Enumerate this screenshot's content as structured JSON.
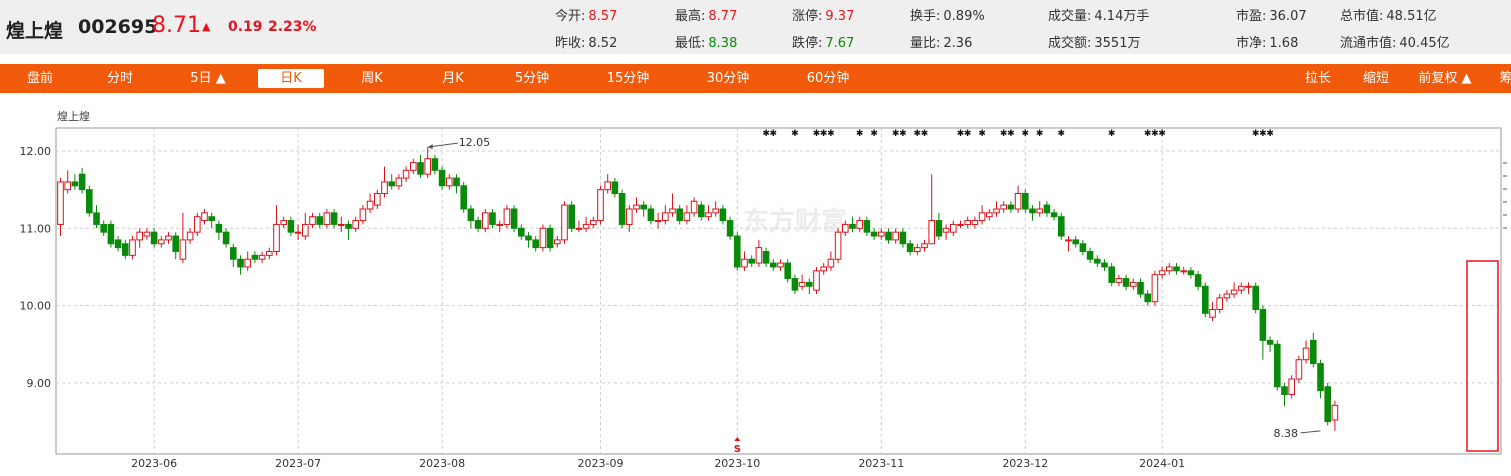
{
  "header": {
    "name": "煌上煌",
    "code": "002695",
    "price": "8.71",
    "arrow": "▲",
    "change": "0.19",
    "change_pct": "2.23%",
    "quotes": [
      {
        "label": "今开:",
        "value": "8.57",
        "color": "red"
      },
      {
        "label": "昨收:",
        "value": "8.52",
        "color": ""
      },
      {
        "label": "最高:",
        "value": "8.77",
        "color": "red"
      },
      {
        "label": "最低:",
        "value": "8.38",
        "color": "green"
      },
      {
        "label": "涨停:",
        "value": "9.37",
        "color": "red"
      },
      {
        "label": "跌停:",
        "value": "7.67",
        "color": "green"
      },
      {
        "label": "换手:",
        "value": "0.89%",
        "color": ""
      },
      {
        "label": "量比:",
        "value": "2.36",
        "color": ""
      },
      {
        "label": "成交量:",
        "value": "4.14万手",
        "color": ""
      },
      {
        "label": "成交额:",
        "value": "3551万",
        "color": ""
      },
      {
        "label": "市盈:",
        "value": "36.07",
        "color": ""
      },
      {
        "label": "市净:",
        "value": "1.68",
        "color": ""
      },
      {
        "label": "总市值:",
        "value": "48.51亿",
        "color": ""
      },
      {
        "label": "流通市值:",
        "value": "40.45亿",
        "color": ""
      }
    ]
  },
  "tabs": {
    "left": [
      "盘前",
      "分时",
      "5日 ▲",
      "日K",
      "周K",
      "月K",
      "5分钟",
      "15分钟",
      "30分钟",
      "60分钟"
    ],
    "active": "日K",
    "right": [
      "拉长",
      "缩短",
      "前复权 ▲",
      "筹"
    ]
  },
  "colors": {
    "up": "#d8141d",
    "down": "#0a8a0a",
    "accent": "#f05a0a",
    "highlight_box": "#e8141d"
  },
  "chart_data": {
    "type": "candlestick",
    "title": "煌上煌",
    "ylim": [
      8.3,
      12.3
    ],
    "yticks": [
      "12.00",
      "11.00",
      "10.00",
      "9.00"
    ],
    "ytick_values": [
      12,
      11,
      10,
      9
    ],
    "xticks": [
      "2023-06",
      "2023-07",
      "2023-08",
      "2023-09",
      "2023-10",
      "2023-11",
      "2023-12",
      "2024-01"
    ],
    "xtick_index": [
      13,
      33,
      53,
      75,
      94,
      114,
      134,
      153
    ],
    "annotations": [
      {
        "text": "12.05",
        "index": 51,
        "value": 12.05
      },
      {
        "text": "8.38",
        "index": 175,
        "value": 8.38
      }
    ],
    "watermark": "东方财富",
    "marker_text": "S",
    "marker_index": 94,
    "star_symbol": "✱",
    "star_indices": [
      98,
      99,
      102,
      105,
      106,
      107,
      111,
      113,
      116,
      117,
      119,
      120,
      125,
      126,
      128,
      131,
      132,
      134,
      136,
      139,
      146,
      151,
      152,
      153,
      166,
      167,
      168
    ],
    "candles": [
      [
        11.05,
        11.6,
        11.65,
        10.9
      ],
      [
        11.5,
        11.6,
        11.75,
        11.45
      ],
      [
        11.6,
        11.55,
        11.7,
        11.5
      ],
      [
        11.7,
        11.5,
        11.78,
        11.45
      ],
      [
        11.5,
        11.2,
        11.55,
        11.15
      ],
      [
        11.2,
        11.05,
        11.3,
        11.0
      ],
      [
        11.05,
        10.95,
        11.1,
        10.9
      ],
      [
        11.05,
        10.8,
        11.1,
        10.75
      ],
      [
        10.85,
        10.75,
        10.9,
        10.7
      ],
      [
        10.8,
        10.65,
        10.85,
        10.6
      ],
      [
        10.65,
        10.85,
        10.9,
        10.6
      ],
      [
        10.85,
        10.95,
        11.0,
        10.75
      ],
      [
        10.9,
        10.95,
        11.0,
        10.85
      ],
      [
        10.95,
        10.8,
        11.0,
        10.75
      ],
      [
        10.8,
        10.85,
        10.9,
        10.75
      ],
      [
        10.85,
        10.9,
        10.95,
        10.8
      ],
      [
        10.9,
        10.7,
        10.95,
        10.6
      ],
      [
        10.6,
        10.85,
        11.2,
        10.55
      ],
      [
        10.85,
        10.95,
        11.0,
        10.8
      ],
      [
        10.95,
        11.15,
        11.2,
        10.9
      ],
      [
        11.1,
        11.2,
        11.25,
        11.05
      ],
      [
        11.15,
        11.1,
        11.2,
        11.0
      ],
      [
        11.05,
        10.95,
        11.1,
        10.85
      ],
      [
        10.95,
        10.8,
        11.0,
        10.75
      ],
      [
        10.75,
        10.6,
        10.8,
        10.5
      ],
      [
        10.6,
        10.5,
        10.65,
        10.4
      ],
      [
        10.5,
        10.6,
        10.7,
        10.45
      ],
      [
        10.65,
        10.6,
        10.7,
        10.55
      ],
      [
        10.6,
        10.65,
        10.7,
        10.55
      ],
      [
        10.65,
        10.7,
        10.75,
        10.6
      ],
      [
        10.7,
        11.05,
        11.3,
        10.65
      ],
      [
        11.05,
        11.1,
        11.15,
        11.0
      ],
      [
        11.1,
        10.95,
        11.15,
        10.9
      ],
      [
        10.95,
        10.95,
        11.05,
        10.85
      ],
      [
        10.9,
        11.05,
        11.2,
        10.85
      ],
      [
        11.05,
        11.15,
        11.2,
        11.0
      ],
      [
        11.15,
        11.05,
        11.2,
        11.0
      ],
      [
        11.05,
        11.2,
        11.25,
        11.0
      ],
      [
        11.2,
        11.05,
        11.25,
        11.0
      ],
      [
        11.05,
        11.05,
        11.15,
        10.95
      ],
      [
        11.05,
        11.0,
        11.1,
        10.85
      ],
      [
        11.0,
        11.1,
        11.15,
        10.95
      ],
      [
        11.1,
        11.25,
        11.3,
        11.05
      ],
      [
        11.25,
        11.35,
        11.45,
        11.2
      ],
      [
        11.3,
        11.45,
        11.5,
        11.25
      ],
      [
        11.45,
        11.6,
        11.8,
        11.4
      ],
      [
        11.6,
        11.55,
        11.7,
        11.5
      ],
      [
        11.55,
        11.65,
        11.7,
        11.5
      ],
      [
        11.65,
        11.75,
        11.8,
        11.6
      ],
      [
        11.75,
        11.85,
        11.9,
        11.7
      ],
      [
        11.85,
        11.7,
        11.95,
        11.65
      ],
      [
        11.7,
        11.9,
        12.05,
        11.65
      ],
      [
        11.9,
        11.75,
        11.95,
        11.7
      ],
      [
        11.75,
        11.55,
        11.8,
        11.5
      ],
      [
        11.55,
        11.65,
        11.7,
        11.5
      ],
      [
        11.65,
        11.55,
        11.7,
        11.45
      ],
      [
        11.55,
        11.25,
        11.6,
        11.2
      ],
      [
        11.25,
        11.1,
        11.3,
        11.0
      ],
      [
        11.1,
        11.0,
        11.15,
        10.95
      ],
      [
        11.0,
        11.2,
        11.25,
        10.95
      ],
      [
        11.2,
        11.05,
        11.25,
        11.0
      ],
      [
        11.05,
        11.05,
        11.1,
        10.95
      ],
      [
        11.05,
        11.25,
        11.3,
        11.0
      ],
      [
        11.25,
        11.0,
        11.3,
        10.95
      ],
      [
        11.0,
        10.9,
        11.05,
        10.85
      ],
      [
        10.9,
        10.85,
        10.95,
        10.75
      ],
      [
        10.85,
        10.75,
        10.9,
        10.7
      ],
      [
        10.75,
        11.0,
        11.05,
        10.7
      ],
      [
        11.0,
        10.75,
        11.05,
        10.7
      ],
      [
        10.8,
        10.85,
        10.9,
        10.75
      ],
      [
        10.85,
        11.3,
        11.35,
        10.8
      ],
      [
        11.3,
        11.0,
        11.35,
        10.95
      ],
      [
        11.0,
        11.0,
        11.1,
        10.95
      ],
      [
        11.0,
        11.05,
        11.15,
        10.95
      ],
      [
        11.05,
        11.1,
        11.15,
        11.0
      ],
      [
        11.1,
        11.5,
        11.55,
        11.05
      ],
      [
        11.5,
        11.6,
        11.7,
        11.45
      ],
      [
        11.6,
        11.45,
        11.65,
        11.4
      ],
      [
        11.45,
        11.05,
        11.5,
        11.0
      ],
      [
        11.05,
        11.25,
        11.3,
        10.95
      ],
      [
        11.25,
        11.3,
        11.4,
        11.2
      ],
      [
        11.3,
        11.25,
        11.35,
        11.15
      ],
      [
        11.25,
        11.1,
        11.3,
        11.05
      ],
      [
        11.1,
        11.1,
        11.2,
        11.0
      ],
      [
        11.1,
        11.2,
        11.3,
        11.05
      ],
      [
        11.2,
        11.25,
        11.45,
        11.15
      ],
      [
        11.25,
        11.1,
        11.3,
        11.05
      ],
      [
        11.1,
        11.2,
        11.3,
        11.05
      ],
      [
        11.2,
        11.35,
        11.4,
        11.15
      ],
      [
        11.3,
        11.15,
        11.35,
        11.1
      ],
      [
        11.15,
        11.2,
        11.3,
        11.1
      ],
      [
        11.2,
        11.25,
        11.35,
        11.15
      ],
      [
        11.25,
        11.1,
        11.3,
        11.05
      ],
      [
        11.1,
        10.9,
        11.15,
        10.85
      ],
      [
        10.9,
        10.5,
        10.95,
        10.45
      ],
      [
        10.5,
        10.6,
        10.7,
        10.45
      ],
      [
        10.6,
        10.55,
        10.65,
        10.5
      ],
      [
        10.55,
        10.75,
        10.85,
        10.5
      ],
      [
        10.7,
        10.55,
        10.75,
        10.5
      ],
      [
        10.55,
        10.5,
        10.6,
        10.45
      ],
      [
        10.5,
        10.55,
        10.6,
        10.45
      ],
      [
        10.55,
        10.35,
        10.6,
        10.3
      ],
      [
        10.35,
        10.2,
        10.4,
        10.15
      ],
      [
        10.25,
        10.3,
        10.4,
        10.2
      ],
      [
        10.3,
        10.25,
        10.35,
        10.15
      ],
      [
        10.2,
        10.45,
        10.5,
        10.15
      ],
      [
        10.45,
        10.5,
        10.55,
        10.4
      ],
      [
        10.5,
        10.6,
        10.7,
        10.45
      ],
      [
        10.6,
        10.95,
        11.0,
        10.55
      ],
      [
        10.95,
        11.05,
        11.1,
        10.9
      ],
      [
        11.05,
        11.0,
        11.15,
        10.95
      ],
      [
        11.0,
        11.1,
        11.15,
        10.95
      ],
      [
        11.1,
        10.95,
        11.15,
        10.9
      ],
      [
        10.95,
        10.9,
        11.0,
        10.85
      ],
      [
        10.9,
        10.95,
        11.0,
        10.85
      ],
      [
        10.95,
        10.85,
        11.0,
        10.8
      ],
      [
        10.85,
        10.95,
        11.0,
        10.8
      ],
      [
        10.95,
        10.8,
        11.0,
        10.75
      ],
      [
        10.8,
        10.7,
        10.85,
        10.65
      ],
      [
        10.7,
        10.75,
        10.8,
        10.65
      ],
      [
        10.75,
        10.8,
        10.85,
        10.7
      ],
      [
        10.8,
        11.1,
        11.7,
        10.8
      ],
      [
        11.1,
        10.9,
        11.2,
        10.85
      ],
      [
        10.95,
        11.0,
        11.05,
        10.85
      ],
      [
        10.95,
        11.05,
        11.1,
        10.9
      ],
      [
        11.05,
        11.05,
        11.1,
        11.0
      ],
      [
        11.05,
        11.1,
        11.15,
        11.0
      ],
      [
        11.05,
        11.1,
        11.15,
        11.0
      ],
      [
        11.1,
        11.2,
        11.3,
        11.05
      ],
      [
        11.15,
        11.2,
        11.25,
        11.1
      ],
      [
        11.2,
        11.25,
        11.35,
        11.15
      ],
      [
        11.25,
        11.3,
        11.35,
        11.2
      ],
      [
        11.3,
        11.25,
        11.35,
        11.2
      ],
      [
        11.25,
        11.45,
        11.55,
        11.2
      ],
      [
        11.45,
        11.25,
        11.5,
        11.2
      ],
      [
        11.25,
        11.2,
        11.3,
        11.1
      ],
      [
        11.2,
        11.25,
        11.35,
        11.15
      ],
      [
        11.3,
        11.2,
        11.35,
        11.15
      ],
      [
        11.2,
        11.15,
        11.25,
        11.1
      ],
      [
        11.15,
        10.9,
        11.2,
        10.85
      ],
      [
        10.85,
        10.85,
        10.9,
        10.7
      ],
      [
        10.85,
        10.8,
        10.9,
        10.75
      ],
      [
        10.8,
        10.7,
        10.85,
        10.65
      ],
      [
        10.7,
        10.6,
        10.75,
        10.55
      ],
      [
        10.6,
        10.55,
        10.65,
        10.5
      ],
      [
        10.55,
        10.5,
        10.6,
        10.45
      ],
      [
        10.5,
        10.3,
        10.55,
        10.25
      ],
      [
        10.3,
        10.35,
        10.4,
        10.25
      ],
      [
        10.35,
        10.25,
        10.4,
        10.2
      ],
      [
        10.25,
        10.3,
        10.35,
        10.2
      ],
      [
        10.3,
        10.15,
        10.35,
        10.1
      ],
      [
        10.15,
        10.05,
        10.2,
        10.0
      ],
      [
        10.05,
        10.4,
        10.45,
        10.0
      ],
      [
        10.4,
        10.45,
        10.5,
        10.35
      ],
      [
        10.45,
        10.5,
        10.55,
        10.4
      ],
      [
        10.5,
        10.45,
        10.55,
        10.4
      ],
      [
        10.45,
        10.45,
        10.5,
        10.4
      ],
      [
        10.45,
        10.4,
        10.5,
        10.35
      ],
      [
        10.4,
        10.25,
        10.45,
        10.2
      ],
      [
        10.25,
        9.9,
        10.3,
        9.85
      ],
      [
        9.85,
        9.95,
        10.05,
        9.8
      ],
      [
        9.95,
        10.1,
        10.15,
        9.9
      ],
      [
        10.1,
        10.15,
        10.2,
        10.05
      ],
      [
        10.15,
        10.2,
        10.3,
        10.1
      ],
      [
        10.2,
        10.25,
        10.3,
        10.15
      ],
      [
        10.25,
        10.25,
        10.3,
        10.15
      ],
      [
        10.25,
        9.95,
        10.3,
        9.9
      ],
      [
        9.95,
        9.55,
        10.0,
        9.3
      ],
      [
        9.55,
        9.5,
        9.6,
        9.4
      ],
      [
        9.5,
        8.95,
        9.55,
        8.9
      ],
      [
        8.95,
        8.85,
        9.0,
        8.7
      ],
      [
        8.85,
        9.05,
        9.1,
        8.8
      ],
      [
        9.05,
        9.3,
        9.35,
        9.0
      ],
      [
        9.3,
        9.45,
        9.55,
        9.25
      ],
      [
        9.55,
        9.25,
        9.65,
        9.2
      ],
      [
        9.25,
        8.9,
        9.3,
        8.8
      ],
      [
        8.95,
        8.5,
        9.0,
        8.45
      ],
      [
        8.52,
        8.71,
        8.77,
        8.38
      ]
    ]
  }
}
